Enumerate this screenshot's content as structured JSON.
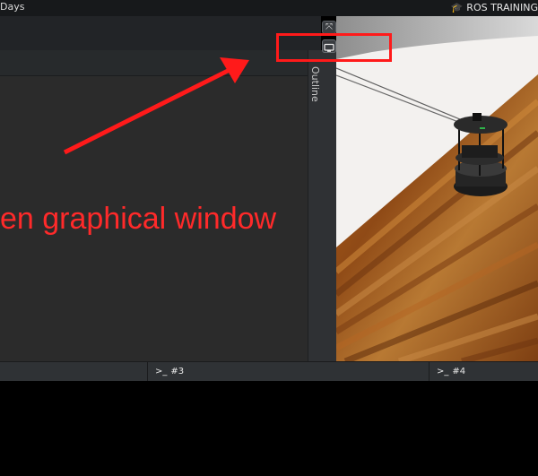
{
  "topbar": {
    "title_fragment": "Days",
    "brand": "ROS TRAINING",
    "brand_icon": "graduation-cap-icon"
  },
  "side_panel": {
    "outline_label": "Outline"
  },
  "viewport_controls": [
    {
      "icon": "fullscreen-toggle-icon",
      "glyph": "⤧"
    },
    {
      "icon": "monitor-icon"
    }
  ],
  "annotation": {
    "text": "en graphical window",
    "color": "#ff2a2a"
  },
  "terminal_tabs": [
    {
      "prompt": ">_",
      "label": "#3"
    },
    {
      "prompt": ">_",
      "label": "#4"
    }
  ],
  "colors": {
    "annotation_red": "#ff1a1a",
    "ide_dark": "#2b2b2b"
  }
}
